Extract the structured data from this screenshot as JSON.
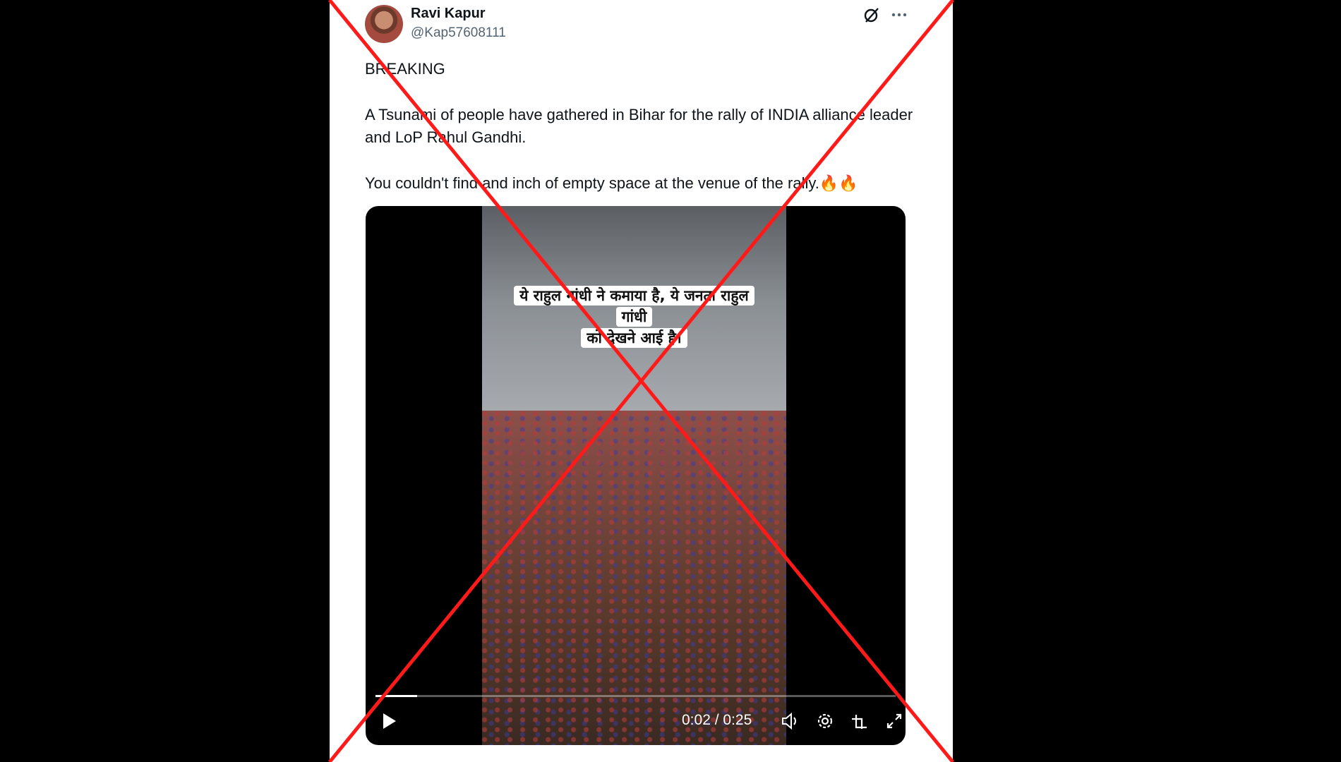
{
  "post": {
    "author_name": "Ravi Kapur",
    "author_handle": "@Kap57608111",
    "text_lines": [
      "BREAKING",
      "A Tsunami of people have gathered in Bihar for the rally of INDIA alliance leader and LoP Rahul Gandhi.",
      "You couldn't find and inch of empty space at the venue of the rally.🔥🔥"
    ]
  },
  "video": {
    "caption_line1": "ये राहुल गांधी ने कमाया है, ये जनता राहुल गांधी",
    "caption_line2": "को देखने आई है।",
    "time_display": "0:02 / 0:25",
    "progress_fraction": 0.08
  },
  "icons": {
    "grok": "grok-icon",
    "more": "more-icon",
    "play": "play-icon",
    "volume": "volume-icon",
    "settings": "settings-icon",
    "pip": "picture-in-picture-icon",
    "fullscreen": "fullscreen-icon"
  },
  "colors": {
    "strike_red": "#ff1a1a",
    "name_text": "#0f1419",
    "handle_text": "#536471"
  }
}
